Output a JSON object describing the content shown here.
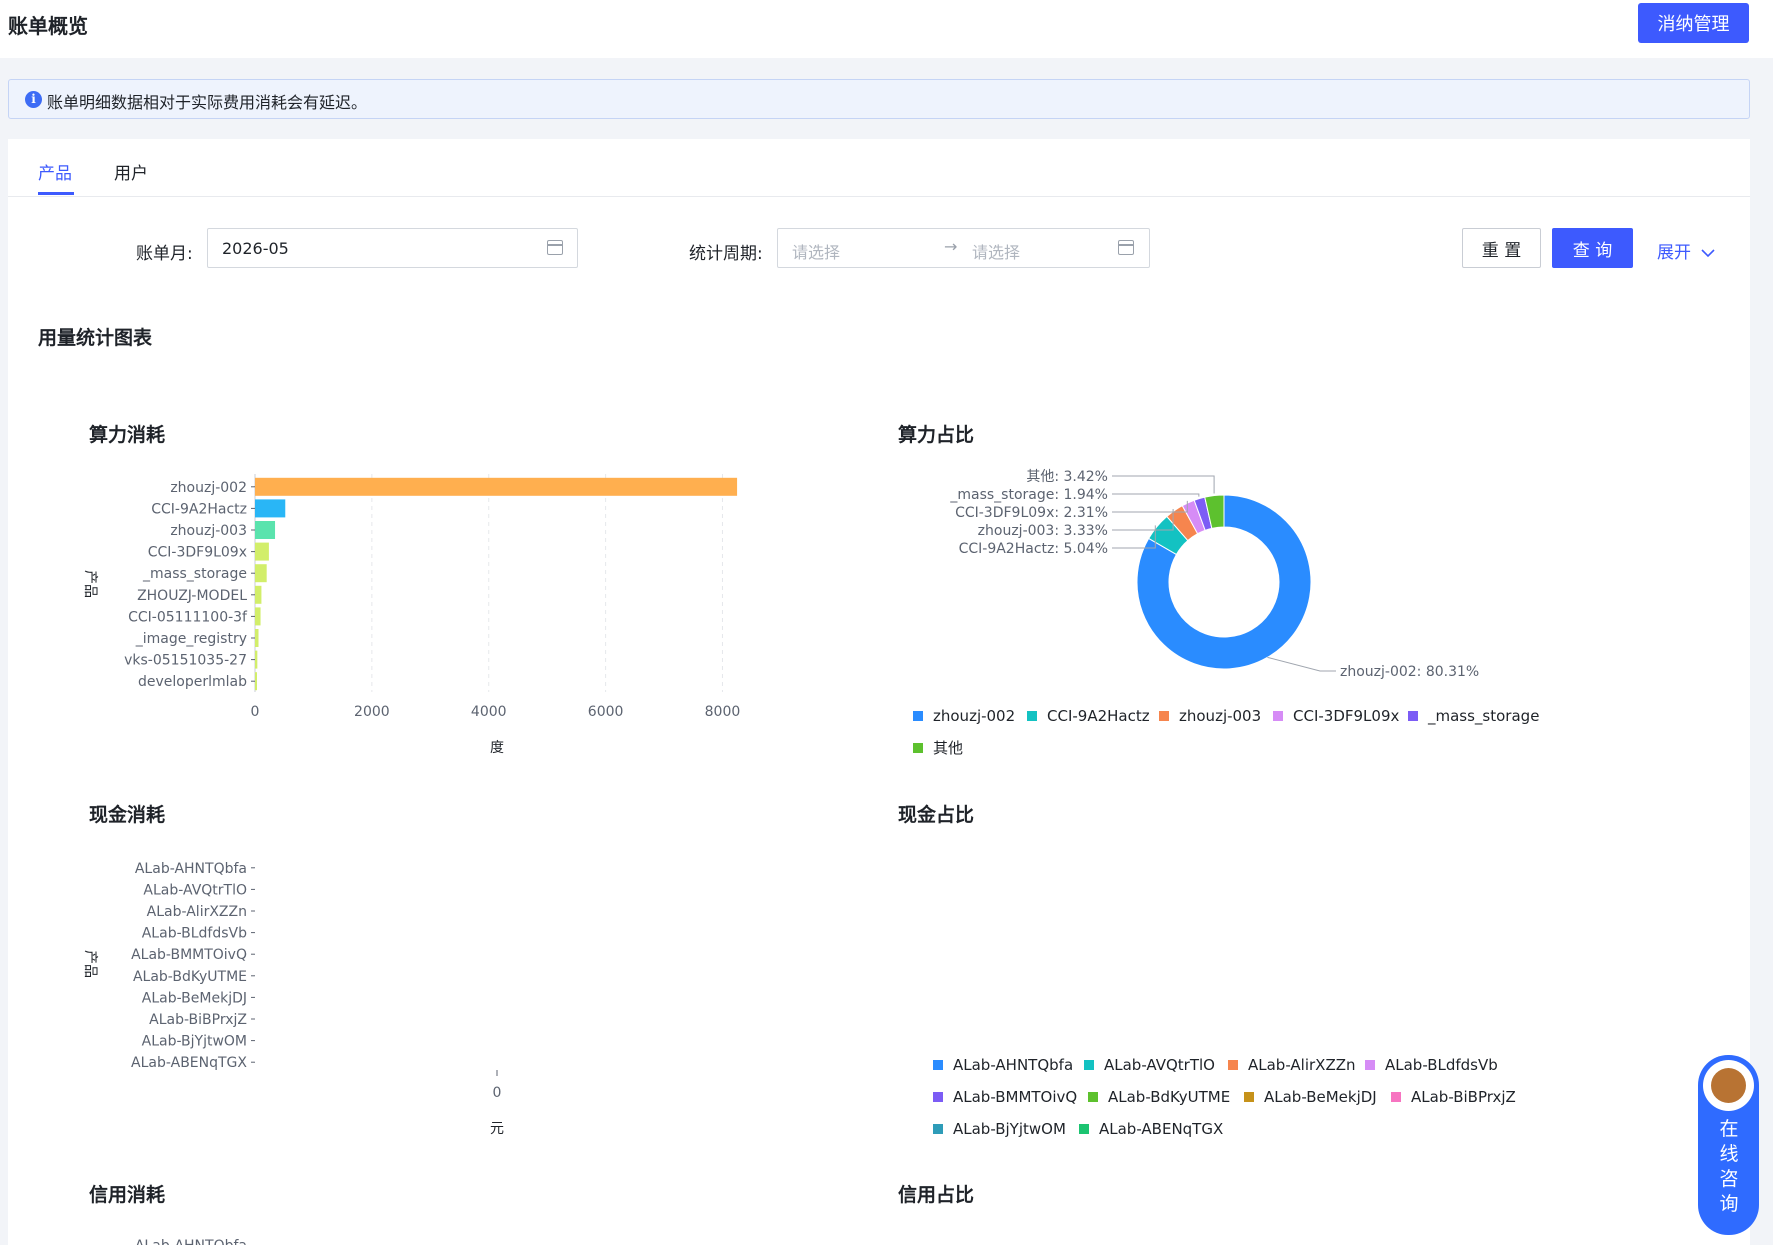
{
  "header": {
    "title": "账单概览",
    "manage_label": "消纳管理"
  },
  "notice": {
    "icon": "info-icon",
    "text": "账单明细数据相对于实际费用消耗会有延迟。"
  },
  "tabs": [
    {
      "label": "产品",
      "active": true
    },
    {
      "label": "用户",
      "active": false
    }
  ],
  "filters": {
    "bill_month_label": "账单月:",
    "bill_month_value": "2026-05",
    "period_label": "统计周期:",
    "period_start_placeholder": "请选择",
    "period_end_placeholder": "请选择",
    "range_separator": "→",
    "reset_label": "重 置",
    "query_label": "查 询",
    "expand_label": "展开"
  },
  "section_title": "用量统计图表",
  "charts": {
    "compute_bar_title": "算力消耗",
    "compute_pie_title": "算力占比",
    "cash_bar_title": "现金消耗",
    "cash_pie_title": "现金占比",
    "credit_bar_title": "信用消耗",
    "credit_pie_title": "信用占比"
  },
  "chart_data": [
    {
      "type": "bar",
      "orientation": "horizontal",
      "title": "算力消耗",
      "categories": [
        "zhouzj-002",
        "CCI-9A2Hactz",
        "zhouzj-003",
        "CCI-3DF9L09x",
        "_mass_storage",
        "ZHOUZJ-MODEL",
        "CCI-05111100-3f",
        "_image_registry",
        "vks-05151035-27",
        "developerlmlab"
      ],
      "values": [
        8250,
        518,
        343,
        238,
        200,
        110,
        95,
        60,
        40,
        15
      ],
      "colors": [
        "#ffaf4f",
        "#29b6f6",
        "#5ae3ad",
        "#d2ee6a",
        "#d2ee6a",
        "#d2ee6a",
        "#d2ee6a",
        "#d2ee6a",
        "#d2ee6a",
        "#d2ee6a"
      ],
      "xlabel": "度",
      "ylabel": "产品",
      "xlim": [
        0,
        8300
      ],
      "xticks": [
        0,
        2000,
        4000,
        6000,
        8000
      ],
      "grid": true
    },
    {
      "type": "pie",
      "style": "donut",
      "title": "算力占比",
      "slices": [
        {
          "name": "zhouzj-002",
          "value": 80.31,
          "label": "zhouzj-002: 80.31%",
          "color": "#2a8cff"
        },
        {
          "name": "CCI-9A2Hactz",
          "value": 5.04,
          "label": "CCI-9A2Hactz: 5.04%",
          "color": "#13c2c2"
        },
        {
          "name": "zhouzj-003",
          "value": 3.33,
          "label": "zhouzj-003: 3.33%",
          "color": "#f6854e"
        },
        {
          "name": "CCI-3DF9L09x",
          "value": 2.31,
          "label": "CCI-3DF9L09x: 2.31%",
          "color": "#d68cf6"
        },
        {
          "name": "_mass_storage",
          "value": 1.94,
          "label": "_mass_storage: 1.94%",
          "color": "#7c5cf5"
        },
        {
          "name": "其他",
          "value": 3.42,
          "label": "其他: 3.42%",
          "color": "#5dc12e"
        }
      ],
      "legend": [
        "zhouzj-002",
        "CCI-9A2Hactz",
        "zhouzj-003",
        "CCI-3DF9L09x",
        "_mass_storage",
        "其他"
      ],
      "legend_position": "bottom"
    },
    {
      "type": "bar",
      "orientation": "horizontal",
      "title": "现金消耗",
      "categories": [
        "ALab-AHNTQbfa",
        "ALab-AVQtrTlO",
        "ALab-AlirXZZn",
        "ALab-BLdfdsVb",
        "ALab-BMMTOivQ",
        "ALab-BdKyUTME",
        "ALab-BeMekjDJ",
        "ALab-BiBPrxjZ",
        "ALab-BjYjtwOM",
        "ALab-ABENqTGX"
      ],
      "values": [
        0,
        0,
        0,
        0,
        0,
        0,
        0,
        0,
        0,
        0
      ],
      "xlabel": "元",
      "ylabel": "产品",
      "xticks": [
        0
      ]
    },
    {
      "type": "pie",
      "title": "现金占比",
      "slices": [],
      "legend": [
        {
          "name": "ALab-AHNTQbfa",
          "color": "#2a8cff"
        },
        {
          "name": "ALab-AVQtrTlO",
          "color": "#13c2c2"
        },
        {
          "name": "ALab-AlirXZZn",
          "color": "#f6854e"
        },
        {
          "name": "ALab-BLdfdsVb",
          "color": "#d68cf6"
        },
        {
          "name": "ALab-BMMTOivQ",
          "color": "#7c5cf5"
        },
        {
          "name": "ALab-BdKyUTME",
          "color": "#5dc12e"
        },
        {
          "name": "ALab-BeMekjDJ",
          "color": "#c6921a"
        },
        {
          "name": "ALab-BiBPrxjZ",
          "color": "#f774c1"
        },
        {
          "name": "ALab-BjYjtwOM",
          "color": "#2e9cb8"
        },
        {
          "name": "ALab-ABENqTGX",
          "color": "#1cc471"
        }
      ],
      "legend_position": "bottom"
    },
    {
      "type": "bar",
      "orientation": "horizontal",
      "title": "信用消耗",
      "categories": [
        "ALab-AHNTQbfa"
      ]
    },
    {
      "type": "pie",
      "title": "信用占比"
    }
  ],
  "chat_widget": {
    "label": "在线咨询",
    "icon": "assistant-avatar-icon"
  }
}
